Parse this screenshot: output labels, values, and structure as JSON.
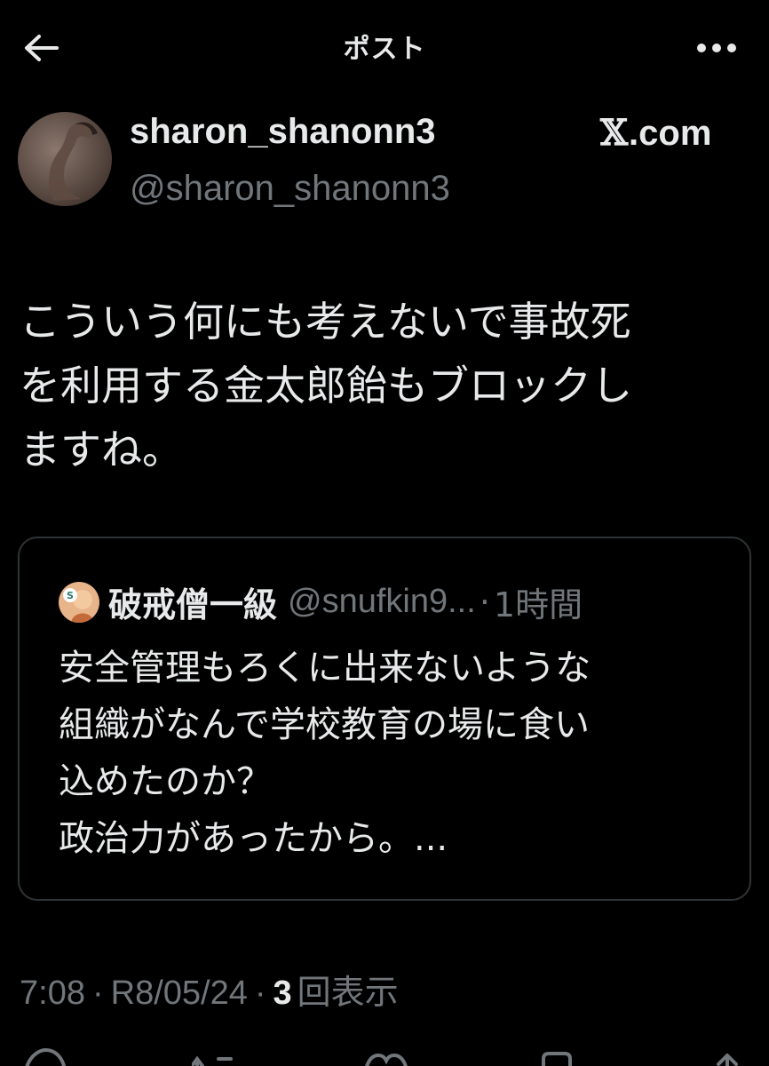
{
  "header": {
    "title": "ポスト"
  },
  "author": {
    "display_name": "sharon_shanonn3",
    "handle": "@sharon_shanonn3",
    "source": ".com"
  },
  "post": {
    "text": "こういう何にも考えないで事故死\nを利用する金太郎飴もブロックし\nますね。"
  },
  "quote": {
    "display_name": "破戒僧一級",
    "handle": "@snufkin9...",
    "separator": "·",
    "time": "1時間",
    "text": "安全管理もろくに出来ないような\n組織がなんで学校教育の場に食い\n込めたのか？\n政治力があったから。..."
  },
  "meta": {
    "time": "7:08",
    "date": "R8/05/24",
    "views_count": "3",
    "views_label": "回表示",
    "separator": "·"
  },
  "colors": {
    "background": "#000000",
    "text": "#e7e9ea",
    "muted": "#71767b",
    "border": "#2f3336"
  },
  "icons": [
    "back-arrow-icon",
    "more-icon",
    "x-logo-icon",
    "reply-icon",
    "repost-icon",
    "like-icon",
    "bookmark-icon"
  ]
}
